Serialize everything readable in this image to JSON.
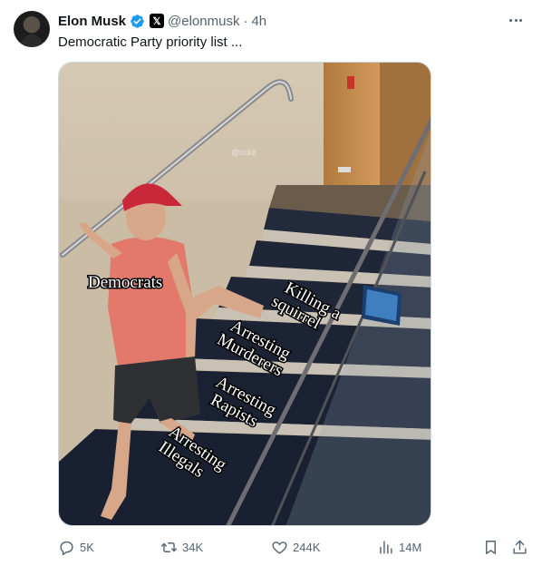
{
  "post": {
    "author_name": "Elon Musk",
    "handle": "@elonmusk",
    "separator": "·",
    "time": "4h",
    "platform_badge": "𝕏",
    "text": "Democratic Party priority list ..."
  },
  "meme": {
    "watermark": "@ricklt",
    "label_democrats": "Democrats",
    "step_top_line1": "Killing a",
    "step_top_line2": "squirrel",
    "step_mid_line1": "Arresting",
    "step_mid_line2": "Murderers",
    "step_low_line1": "Arresting",
    "step_low_line2": "Rapists",
    "step_bottom_line1": "Arresting",
    "step_bottom_line2": "Illegals"
  },
  "actions": {
    "replies": "5K",
    "reposts": "34K",
    "likes": "244K",
    "views": "14M"
  },
  "icons": {
    "verified": "verified-badge-icon",
    "more": "more-options-icon",
    "reply": "reply-icon",
    "repost": "repost-icon",
    "like": "heart-icon",
    "views": "views-bar-chart-icon",
    "bookmark": "bookmark-icon",
    "share": "share-icon"
  },
  "colors": {
    "verified_blue": "#1d9bf0",
    "secondary_text": "#536471",
    "primary_text": "#0f1419"
  }
}
